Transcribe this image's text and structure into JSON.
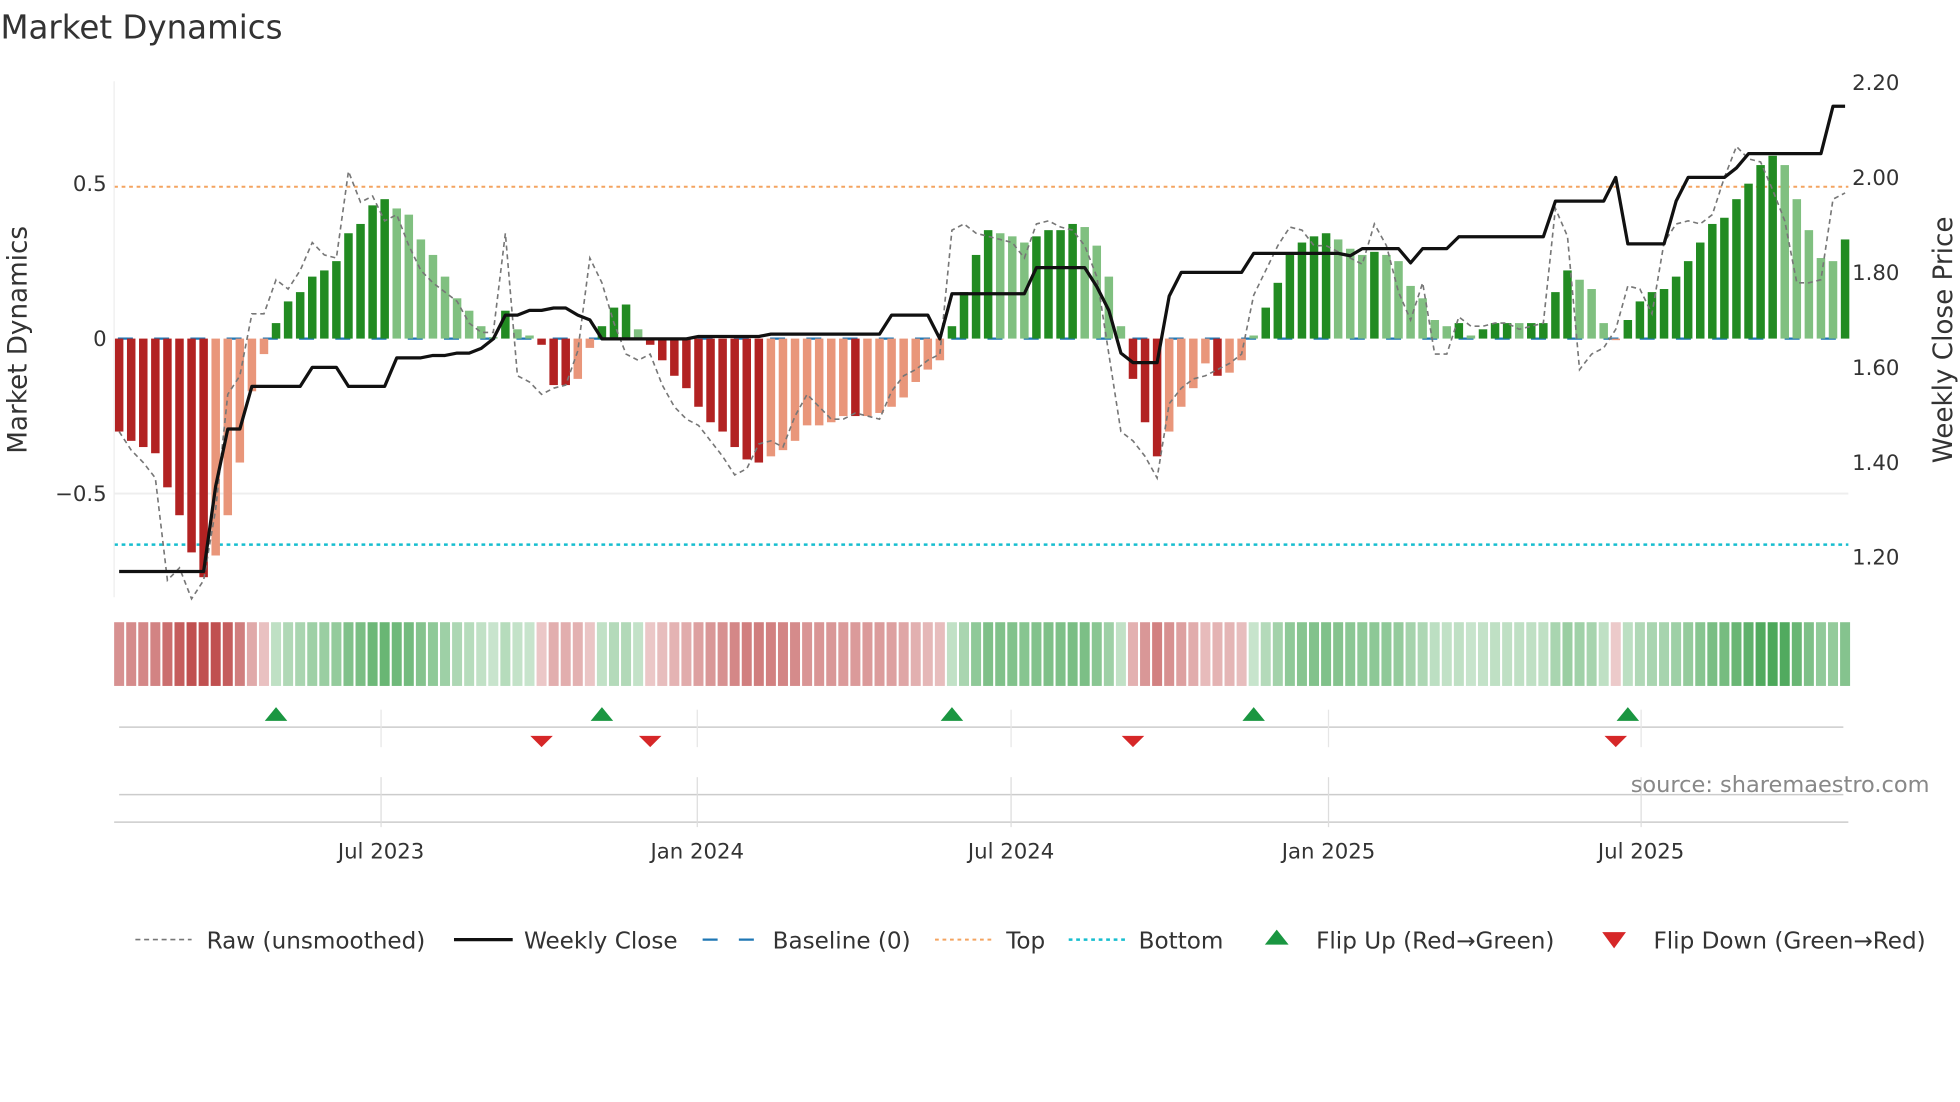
{
  "title": "Market Dynamics",
  "source_text": "source: sharemaestro.com",
  "colors": {
    "strong_neg": "#b22222",
    "weak_neg": "#e9967a",
    "strong_pos": "#228b22",
    "weak_pos": "#80c080",
    "raw": "#777777",
    "close": "#111111",
    "baseline": "#1f77b4",
    "top": "#f4a460",
    "bottom": "#17becf",
    "flip_up": "#1a9641",
    "flip_down": "#d62728"
  },
  "chart_data": {
    "type": "bar",
    "title": "Market Dynamics",
    "ylabel": "Market Dynamics",
    "y2label": "Weekly Close Price",
    "ylim": [
      -0.85,
      0.83
    ],
    "y2lim": [
      1.1,
      2.23
    ],
    "yticks": [
      {
        "v": 0.5,
        "label": "0.5"
      },
      {
        "v": 0,
        "label": "0"
      },
      {
        "v": -0.5,
        "label": "−0.5"
      }
    ],
    "y2ticks": [
      {
        "v": 1.2,
        "label": "1.20"
      },
      {
        "v": 1.4,
        "label": "1.40"
      },
      {
        "v": 1.6,
        "label": "1.60"
      },
      {
        "v": 1.8,
        "label": "1.80"
      },
      {
        "v": 2.0,
        "label": "2.00"
      },
      {
        "v": 2.2,
        "label": "2.20"
      }
    ],
    "xticks": [
      {
        "week": 21.7,
        "label": "Jul 2023"
      },
      {
        "week": 47.9,
        "label": "Jan 2024"
      },
      {
        "week": 73.9,
        "label": "Jul 2024"
      },
      {
        "week": 100.2,
        "label": "Jan 2025"
      },
      {
        "week": 126.1,
        "label": "Jul 2025"
      }
    ],
    "x_unit": "week index",
    "top_level": 0.49,
    "bottom_level": -0.665,
    "baseline": 0,
    "values": [
      -0.3,
      -0.33,
      -0.35,
      -0.37,
      -0.48,
      -0.57,
      -0.69,
      -0.77,
      -0.7,
      -0.57,
      -0.4,
      -0.17,
      -0.05,
      0.05,
      0.12,
      0.15,
      0.2,
      0.22,
      0.25,
      0.34,
      0.37,
      0.43,
      0.45,
      0.42,
      0.4,
      0.32,
      0.27,
      0.2,
      0.13,
      0.09,
      0.04,
      0.005,
      0.09,
      0.03,
      0.01,
      -0.02,
      -0.15,
      -0.15,
      -0.13,
      -0.03,
      0.04,
      0.1,
      0.11,
      0.03,
      -0.02,
      -0.07,
      -0.12,
      -0.16,
      -0.22,
      -0.27,
      -0.3,
      -0.35,
      -0.39,
      -0.4,
      -0.38,
      -0.36,
      -0.33,
      -0.28,
      -0.28,
      -0.27,
      -0.25,
      -0.25,
      -0.25,
      -0.24,
      -0.22,
      -0.19,
      -0.14,
      -0.1,
      -0.07,
      0.04,
      0.15,
      0.27,
      0.35,
      0.34,
      0.33,
      0.31,
      0.33,
      0.35,
      0.35,
      0.37,
      0.36,
      0.3,
      0.2,
      0.04,
      -0.13,
      -0.27,
      -0.38,
      -0.3,
      -0.22,
      -0.16,
      -0.08,
      -0.12,
      -0.11,
      -0.07,
      0.01,
      0.1,
      0.18,
      0.27,
      0.31,
      0.33,
      0.34,
      0.32,
      0.29,
      0.27,
      0.28,
      0.27,
      0.25,
      0.17,
      0.13,
      0.06,
      0.04,
      0.05,
      0.01,
      0.03,
      0.05,
      0.05,
      0.05,
      0.05,
      0.05,
      0.15,
      0.22,
      0.19,
      0.16,
      0.05,
      -0.005,
      0.06,
      0.12,
      0.15,
      0.16,
      0.2,
      0.25,
      0.31,
      0.37,
      0.39,
      0.45,
      0.5,
      0.56,
      0.59,
      0.56,
      0.45,
      0.35,
      0.26,
      0.25,
      0.32
    ],
    "strong": [
      1,
      1,
      1,
      1,
      1,
      1,
      1,
      1,
      0,
      0,
      0,
      0,
      0,
      1,
      1,
      1,
      1,
      1,
      1,
      1,
      1,
      1,
      1,
      0,
      0,
      0,
      0,
      0,
      0,
      0,
      0,
      0,
      1,
      0,
      0,
      1,
      1,
      1,
      0,
      0,
      1,
      1,
      1,
      0,
      1,
      1,
      1,
      1,
      1,
      1,
      1,
      1,
      1,
      1,
      0,
      0,
      0,
      0,
      0,
      0,
      0,
      1,
      0,
      0,
      0,
      0,
      0,
      0,
      0,
      1,
      1,
      1,
      1,
      0,
      0,
      0,
      1,
      1,
      1,
      1,
      0,
      0,
      0,
      0,
      1,
      1,
      1,
      0,
      0,
      0,
      0,
      1,
      0,
      0,
      0,
      1,
      1,
      1,
      1,
      1,
      1,
      0,
      0,
      0,
      1,
      0,
      0,
      0,
      0,
      0,
      0,
      1,
      0,
      1,
      1,
      1,
      0,
      1,
      1,
      1,
      1,
      0,
      0,
      0,
      0,
      1,
      1,
      1,
      1,
      1,
      1,
      1,
      1,
      1,
      1,
      1,
      1,
      1,
      0,
      0,
      0,
      0,
      0,
      1
    ],
    "raw": [
      -0.3,
      -0.36,
      -0.4,
      -0.45,
      -0.78,
      -0.74,
      -0.84,
      -0.78,
      -0.55,
      -0.18,
      -0.12,
      0.08,
      0.08,
      0.19,
      0.16,
      0.22,
      0.31,
      0.27,
      0.26,
      0.54,
      0.44,
      0.46,
      0.38,
      0.4,
      0.3,
      0.22,
      0.18,
      0.15,
      0.12,
      0.05,
      0.02,
      0.02,
      0.34,
      -0.12,
      -0.14,
      -0.18,
      -0.16,
      -0.15,
      -0.04,
      0.26,
      0.18,
      0.05,
      -0.05,
      -0.07,
      -0.05,
      -0.15,
      -0.22,
      -0.26,
      -0.28,
      -0.33,
      -0.38,
      -0.44,
      -0.42,
      -0.34,
      -0.33,
      -0.35,
      -0.25,
      -0.18,
      -0.22,
      -0.26,
      -0.26,
      -0.24,
      -0.25,
      -0.26,
      -0.17,
      -0.12,
      -0.1,
      -0.07,
      -0.05,
      0.35,
      0.37,
      0.34,
      0.33,
      0.32,
      0.31,
      0.26,
      0.37,
      0.38,
      0.36,
      0.35,
      0.3,
      0.2,
      -0.05,
      -0.3,
      -0.33,
      -0.38,
      -0.45,
      -0.21,
      -0.16,
      -0.13,
      -0.12,
      -0.1,
      -0.08,
      -0.05,
      0.14,
      0.22,
      0.3,
      0.36,
      0.35,
      0.3,
      0.3,
      0.28,
      0.26,
      0.24,
      0.37,
      0.3,
      0.15,
      0.06,
      0.18,
      -0.05,
      -0.05,
      0.07,
      0.04,
      0.04,
      0.05,
      0.05,
      0.03,
      0.04,
      0.05,
      0.42,
      0.33,
      -0.1,
      -0.05,
      -0.03,
      0.03,
      0.17,
      0.16,
      0.08,
      0.31,
      0.37,
      0.38,
      0.37,
      0.4,
      0.52,
      0.62,
      0.58,
      0.57,
      0.48,
      0.38,
      0.18,
      0.18,
      0.19,
      0.45,
      0.47
    ],
    "close": [
      1.17,
      1.17,
      1.17,
      1.17,
      1.17,
      1.17,
      1.17,
      1.17,
      1.35,
      1.47,
      1.47,
      1.56,
      1.56,
      1.56,
      1.56,
      1.56,
      1.6,
      1.6,
      1.6,
      1.56,
      1.56,
      1.56,
      1.56,
      1.62,
      1.62,
      1.62,
      1.625,
      1.625,
      1.63,
      1.63,
      1.64,
      1.66,
      1.71,
      1.71,
      1.72,
      1.72,
      1.725,
      1.725,
      1.71,
      1.7,
      1.66,
      1.66,
      1.66,
      1.66,
      1.66,
      1.66,
      1.66,
      1.66,
      1.665,
      1.665,
      1.665,
      1.665,
      1.665,
      1.665,
      1.67,
      1.67,
      1.67,
      1.67,
      1.67,
      1.67,
      1.67,
      1.67,
      1.67,
      1.67,
      1.71,
      1.71,
      1.71,
      1.71,
      1.66,
      1.755,
      1.755,
      1.755,
      1.755,
      1.755,
      1.755,
      1.755,
      1.81,
      1.81,
      1.81,
      1.81,
      1.81,
      1.77,
      1.72,
      1.63,
      1.61,
      1.61,
      1.61,
      1.75,
      1.8,
      1.8,
      1.8,
      1.8,
      1.8,
      1.8,
      1.84,
      1.84,
      1.84,
      1.84,
      1.84,
      1.84,
      1.84,
      1.84,
      1.835,
      1.85,
      1.85,
      1.85,
      1.85,
      1.82,
      1.85,
      1.85,
      1.85,
      1.875,
      1.875,
      1.875,
      1.875,
      1.875,
      1.875,
      1.875,
      1.875,
      1.95,
      1.95,
      1.95,
      1.95,
      1.95,
      2.0,
      1.86,
      1.86,
      1.86,
      1.86,
      1.95,
      2.0,
      2.0,
      2.0,
      2.0,
      2.02,
      2.05,
      2.05,
      2.05,
      2.05,
      2.05,
      2.05,
      2.05,
      2.15,
      2.15
    ],
    "flips_up": [
      13,
      40,
      69,
      94,
      125
    ],
    "flips_down": [
      35,
      44,
      84,
      124
    ],
    "legend": {
      "placement": "bottom",
      "items": [
        {
          "key": "raw",
          "label": "Raw (unsmoothed)"
        },
        {
          "key": "close",
          "label": "Weekly Close"
        },
        {
          "key": "baseline",
          "label": "Baseline (0)"
        },
        {
          "key": "top",
          "label": "Top"
        },
        {
          "key": "bottom",
          "label": "Bottom"
        },
        {
          "key": "flip_up",
          "label": "Flip Up (Red→Green)"
        },
        {
          "key": "flip_down",
          "label": "Flip Down (Green→Red)"
        }
      ]
    }
  }
}
